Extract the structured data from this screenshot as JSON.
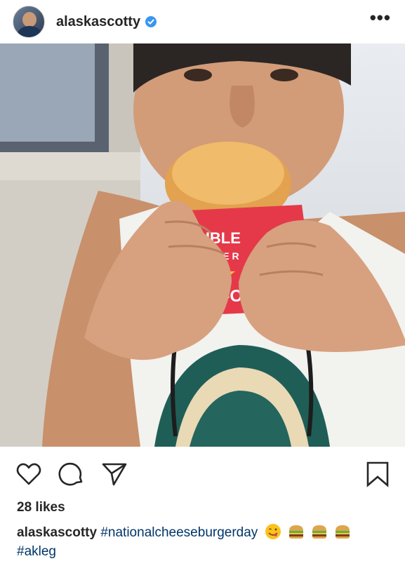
{
  "post": {
    "username": "alaskascotty",
    "verified": true,
    "more_icon": "•••",
    "likes_text": "28 likes",
    "caption": {
      "username": "alaskascotty",
      "hashtag1": "#nationalcheeseburgerday",
      "hashtag2": "#akleg",
      "emojis": [
        "face-savoring-food-emoji",
        "hamburger-emoji",
        "hamburger-emoji",
        "hamburger-emoji"
      ]
    },
    "photo_text": {
      "line1": "DOUBLE",
      "line2": "BURGER",
      "brand": "IN-N-OUT"
    }
  },
  "colors": {
    "text": "#262626",
    "hashtag": "#003569",
    "verified": "#3897f0",
    "wrapper_red": "#e5394a",
    "star_yellow": "#f7c531"
  }
}
